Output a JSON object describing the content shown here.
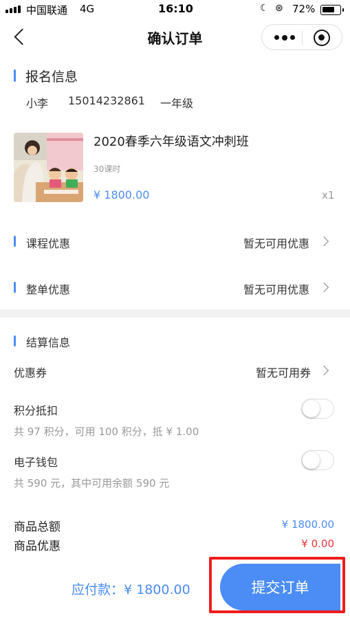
{
  "status_bar": {
    "carrier": "中国联通",
    "network": "4G",
    "time": "16:10",
    "battery_percent": "72%",
    "battery_level": 0.72
  },
  "navbar": {
    "title": "确认订单"
  },
  "registration": {
    "title": "报名信息",
    "name": "小李",
    "phone": "15014232861",
    "grade": "一年级"
  },
  "course": {
    "title": "2020春季六年级语文冲刺班",
    "hours": "30课时",
    "price": "¥ 1800.00",
    "quantity": "x1"
  },
  "discounts": {
    "course_label": "课程优惠",
    "course_value": "暂无可用优惠",
    "order_label": "整单优惠",
    "order_value": "暂无可用优惠"
  },
  "settlement": {
    "title": "结算信息",
    "coupon_label": "优惠券",
    "coupon_value": "暂无可用券",
    "points_label": "积分抵扣",
    "points_detail": "共 97 积分，可用 100 积分，抵 ¥ 1.00",
    "points_enabled": false,
    "wallet_label": "电子钱包",
    "wallet_detail": "共 590 元，其中可用余额 590 元",
    "wallet_enabled": false
  },
  "summary": {
    "total_label": "商品总额",
    "total_value": "¥ 1800.00",
    "discount_label": "商品优惠",
    "discount_value": "¥ 0.00"
  },
  "footer": {
    "payable_label": "应付款：¥ 1800.00",
    "submit_label": "提交订单"
  },
  "colors": {
    "accent": "#4b8cf5",
    "discount_red": "#e8343a",
    "highlight_red": "#f01c1c"
  }
}
